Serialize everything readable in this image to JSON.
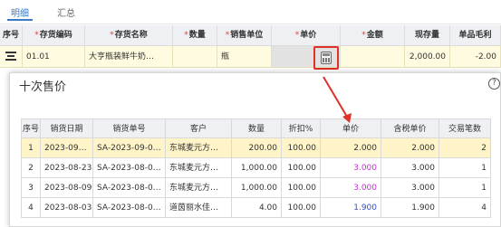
{
  "tabs": {
    "active": "明细",
    "inactive": "汇总"
  },
  "main_grid": {
    "headers": [
      {
        "label": "序号",
        "required": false
      },
      {
        "label": "存货编码",
        "required": true
      },
      {
        "label": "存货名称",
        "required": true
      },
      {
        "label": "数量",
        "required": true
      },
      {
        "label": "销售单位",
        "required": true
      },
      {
        "label": "单价",
        "required": true
      },
      {
        "label": "金额",
        "required": true
      },
      {
        "label": "现存量",
        "required": false
      },
      {
        "label": "单品毛利",
        "required": false
      }
    ],
    "row": {
      "code": "01.01",
      "name": "大亨瓶装鲜牛奶…",
      "qty": "",
      "unit": "瓶",
      "price": "",
      "amount": "",
      "stock": "2,000.00",
      "margin": "-2.00"
    }
  },
  "popup": {
    "title": "十次售价",
    "help": "?",
    "headers": [
      "序号",
      "销货日期",
      "销货单号",
      "客户",
      "数量",
      "折扣%",
      "单价",
      "含税单价",
      "交易笔数"
    ],
    "rows": [
      {
        "no": "1",
        "date": "2023-09…",
        "order": "SA-2023-09-0…",
        "customer": "东城麦元方…",
        "qty": "200.00",
        "discount": "100.00",
        "price": "2.000",
        "tax_price": "2.000",
        "count": "2"
      },
      {
        "no": "2",
        "date": "2023-08-23",
        "order": "SA-2023-08-0…",
        "customer": "东城麦元方…",
        "qty": "1,000.00",
        "discount": "100.00",
        "price": "3.000",
        "tax_price": "3.000",
        "count": "1"
      },
      {
        "no": "3",
        "date": "2023-08-09",
        "order": "SA-2023-08-0…",
        "customer": "东城麦元方…",
        "qty": "1,000.00",
        "discount": "100.00",
        "price": "3.000",
        "tax_price": "3.000",
        "count": "1"
      },
      {
        "no": "4",
        "date": "2023-08-03",
        "order": "SA-2023-08-0…",
        "customer": "道茵丽水佳…",
        "qty": "4.00",
        "discount": "100.00",
        "price": "1.900",
        "tax_price": "1.900",
        "count": "4"
      }
    ]
  },
  "colors": {
    "accent": "#3b78c6",
    "highlight_red": "#e0302a",
    "selected_row": "#fff3c8",
    "price_purple": "#c030d0",
    "price_blue": "#3050c8"
  }
}
